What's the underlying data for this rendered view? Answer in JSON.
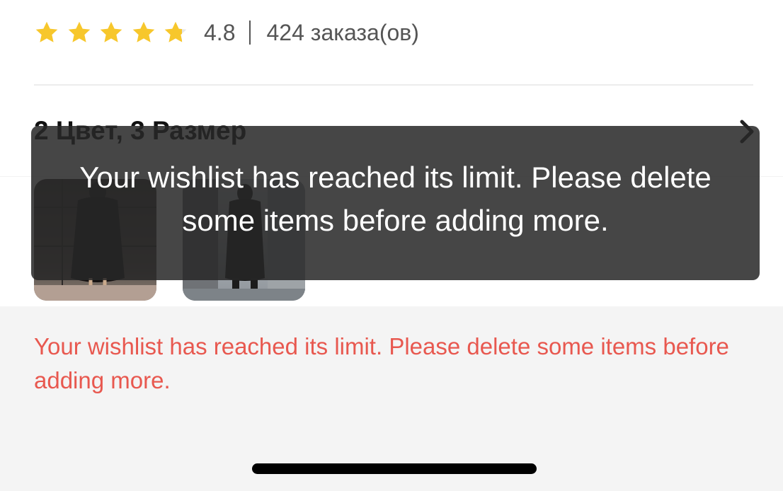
{
  "rating": {
    "stars": 4.8,
    "max_stars": 5,
    "value": "4.8",
    "orders": "424 заказа(ов)",
    "star_color": "#f7c72c"
  },
  "variants": {
    "heading": "2 Цвет, 3 Размер",
    "thumbnails": [
      {
        "name": "black-long-puffer-coat-photo-1"
      },
      {
        "name": "black-long-puffer-coat-photo-2"
      }
    ]
  },
  "error_message": "Your wishlist has reached its limit. Please delete some items before adding more.",
  "error_color": "#e8584f",
  "toast": {
    "message": "Your wishlist has reached its limit. Please delete some items before adding more."
  }
}
